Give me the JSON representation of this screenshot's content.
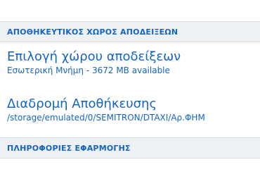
{
  "top_item": {
    "summary": ""
  },
  "sections": [
    {
      "header": "ΑΠΟΘΗΚΕΥΤΙΚΟΣ ΧΩΡΟΣ ΑΠΟΔΕΙΞΕΩΝ"
    },
    {
      "header": "ΠΛΗΡΟΦΟΡΙΕΣ ΕΦΑΡΜΟΓΗΣ"
    }
  ],
  "preferences": {
    "receipts_location": {
      "title": "Επιλογή χώρου αποδείξεων",
      "summary": "Εσωτερική Μνήμη - 3672 MB available"
    },
    "storage_path": {
      "title": "Διαδρομή Αποθήκευσης",
      "summary": "/storage/emulated/0/SEMITRON/DTAXI/Αρ.ΦΗΜ"
    },
    "app_info_first": {
      "title": ""
    }
  },
  "colors": {
    "accent": "#1565c0",
    "section_bg": "#eef1f3",
    "background": "#ffffff"
  }
}
